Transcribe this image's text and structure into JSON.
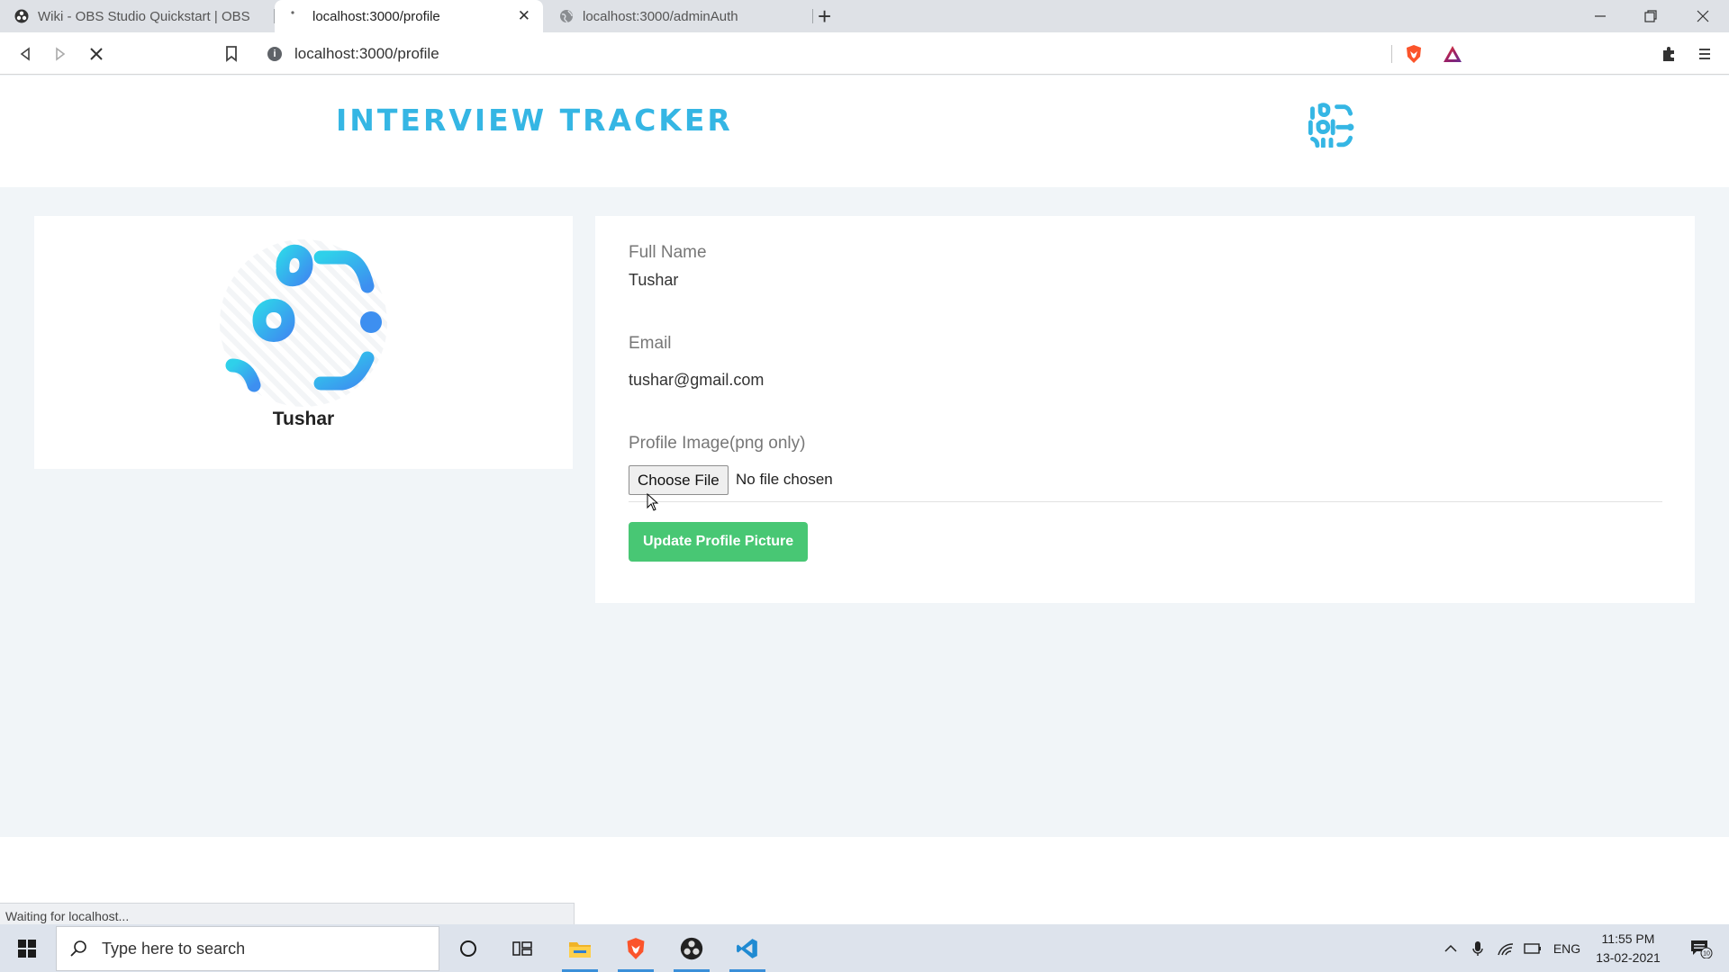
{
  "browser": {
    "tabs": [
      {
        "title": "Wiki - OBS Studio Quickstart | OBS",
        "active": false
      },
      {
        "title": "localhost:3000/profile",
        "active": true
      },
      {
        "title": "localhost:3000/adminAuth",
        "active": false
      }
    ],
    "url": "localhost:3000/profile",
    "status": "Waiting for localhost..."
  },
  "site": {
    "brand": "INTERVIEW TRACKER",
    "accent": "#35b6e4"
  },
  "profile": {
    "name": "Tushar",
    "fields": {
      "full_name_label": "Full Name",
      "full_name_value": "Tushar",
      "email_label": "Email",
      "email_value": "tushar@gmail.com",
      "image_label": "Profile Image(png only)",
      "choose_file_label": "Choose File",
      "file_status": "No file chosen",
      "update_label": "Update Profile Picture"
    },
    "button_color": "#48c774"
  },
  "taskbar": {
    "search_placeholder": "Type here to search",
    "language": "ENG",
    "time": "11:55 PM",
    "date": "13-02-2021",
    "notification_count": "10"
  }
}
